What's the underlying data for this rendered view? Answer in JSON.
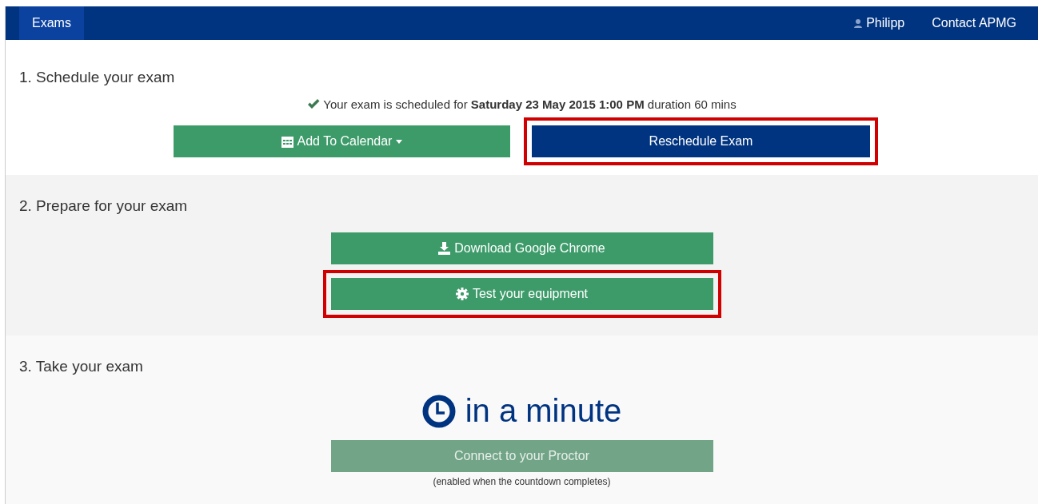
{
  "navbar": {
    "tabs": [
      {
        "label": "Exams",
        "selected": true
      }
    ],
    "user": "Philipp",
    "links": [
      "Contact APMG"
    ]
  },
  "sections": [
    {
      "heading": "1. Schedule your exam",
      "kind": "schedule",
      "scheduled": {
        "before": "Your exam is scheduled for **Saturday 23 May 2015 1:00 PM** duration 60 mins"
      },
      "buttons": [
        {
          "label": "Add To Calendar",
          "kind": "calendar",
          "highlighted": false
        },
        {
          "label": "Reschedule Exam",
          "kind": "reschedule",
          "highlighted": true
        }
      ]
    },
    {
      "heading": "2. Prepare for your exam",
      "kind": "prepare",
      "buttons": [
        {
          "label": "Download Google Chrome",
          "kind": "download",
          "highlighted": false
        },
        {
          "label": "Test your equipment",
          "kind": "gear",
          "highlighted": true
        }
      ]
    },
    {
      "heading": "3. Take your exam",
      "kind": "take",
      "countdown": "in a minute",
      "button": {
        "label": "Connect to your Proctor",
        "disabled": true
      },
      "note": "(enabled when the countdown completes)"
    }
  ]
}
